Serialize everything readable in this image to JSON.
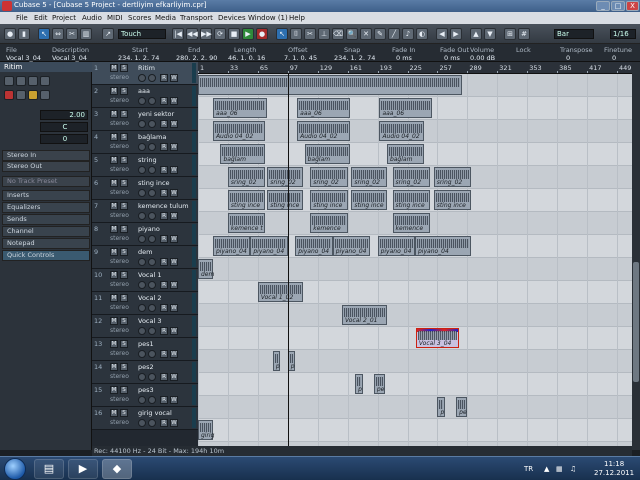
{
  "window": {
    "title": "Cubase 5 - [Cubase 5 Project - dertliyim efkarliyim.cpr]",
    "minimize": "_",
    "maximize": "□",
    "close": "X"
  },
  "menu": [
    "File",
    "Edit",
    "Project",
    "Audio",
    "MIDI",
    "Scores",
    "Media",
    "Transport",
    "Devices",
    "Window (1)",
    "Help"
  ],
  "toolbar": {
    "automation_mode": "Touch",
    "snap_type": "Bar",
    "quantize": "1/16",
    "icons": [
      "arrow-tool",
      "range-tool",
      "split-tool",
      "glue-tool",
      "erase-tool",
      "zoom-tool",
      "mute-tool",
      "draw-tool",
      "play-tool",
      "rewind",
      "forward",
      "stop",
      "play",
      "record",
      "cycle"
    ]
  },
  "infoline": {
    "headers": [
      "File",
      "Description",
      "Start",
      "End",
      "Length",
      "Offset",
      "Snap",
      "Fade In",
      "Fade Out",
      "Volume",
      "Lock",
      "Transpose",
      "Finetune"
    ],
    "values": [
      "Vocal 3_04",
      "Vocal 3_04",
      "234. 1. 2. 74",
      "280. 2. 2. 90",
      "46. 1. 0. 16",
      "7. 1. 0. 45",
      "234. 1. 2. 74",
      "0 ms",
      "0 ms",
      "0.00 dB",
      "",
      "0",
      "0"
    ]
  },
  "inspector": {
    "track_name": "Ritim",
    "volume": "2.00",
    "pan": "C",
    "delay": "0",
    "routing_in": "Stereo In",
    "routing_out": "Stereo Out",
    "preset": "No Track Preset",
    "sections": [
      "Inserts",
      "Equalizers",
      "Sends",
      "Channel",
      "Notepad",
      "Quick Controls"
    ]
  },
  "ruler": {
    "ticks": [
      "1",
      "33",
      "65",
      "97",
      "129",
      "161",
      "193",
      "225",
      "257",
      "289",
      "321",
      "353",
      "385",
      "417",
      "449"
    ]
  },
  "tracks": [
    {
      "num": "1",
      "name": "Ritim",
      "type": "stereo"
    },
    {
      "num": "2",
      "name": "aaa",
      "type": "stereo"
    },
    {
      "num": "3",
      "name": "yeni sektor",
      "type": "stereo"
    },
    {
      "num": "4",
      "name": "bağlama",
      "type": "stereo"
    },
    {
      "num": "5",
      "name": "string",
      "type": "stereo"
    },
    {
      "num": "6",
      "name": "sting ince",
      "type": "stereo"
    },
    {
      "num": "7",
      "name": "kemence tulum",
      "type": "stereo"
    },
    {
      "num": "8",
      "name": "piyano",
      "type": "stereo"
    },
    {
      "num": "9",
      "name": "dem",
      "type": "stereo"
    },
    {
      "num": "10",
      "name": "Vocal 1",
      "type": "stereo"
    },
    {
      "num": "11",
      "name": "Vocal 2",
      "type": "stereo"
    },
    {
      "num": "12",
      "name": "Vocal 3",
      "type": "stereo"
    },
    {
      "num": "13",
      "name": "pes1",
      "type": "stereo"
    },
    {
      "num": "14",
      "name": "pes2",
      "type": "stereo"
    },
    {
      "num": "15",
      "name": "pes3",
      "type": "stereo"
    },
    {
      "num": "16",
      "name": "girig vocal",
      "type": "stereo"
    }
  ],
  "track_buttons": {
    "mute": "M",
    "solo": "S",
    "read": "R",
    "write": "W"
  },
  "events": [
    {
      "track": 0,
      "label": "",
      "from": 1,
      "to": 283
    },
    {
      "track": 1,
      "label": "aaa_06",
      "from": 17,
      "to": 75
    },
    {
      "track": 1,
      "label": "aaa_06",
      "from": 107,
      "to": 163
    },
    {
      "track": 1,
      "label": "aaa_06",
      "from": 195,
      "to": 251
    },
    {
      "track": 2,
      "label": "Audio 04_02",
      "from": 17,
      "to": 73
    },
    {
      "track": 2,
      "label": "Audio 04_02",
      "from": 107,
      "to": 163
    },
    {
      "track": 2,
      "label": "Audio 04_02",
      "from": 195,
      "to": 243
    },
    {
      "track": 3,
      "label": "bağlam",
      "from": 25,
      "to": 73
    },
    {
      "track": 3,
      "label": "bağlam",
      "from": 115,
      "to": 163
    },
    {
      "track": 3,
      "label": "bağlam",
      "from": 203,
      "to": 243
    },
    {
      "track": 4,
      "label": "sring_02",
      "from": 33,
      "to": 73
    },
    {
      "track": 4,
      "label": "sring_02",
      "from": 75,
      "to": 113
    },
    {
      "track": 4,
      "label": "sring_02",
      "from": 121,
      "to": 161
    },
    {
      "track": 4,
      "label": "sring_02",
      "from": 165,
      "to": 203
    },
    {
      "track": 4,
      "label": "sring_02",
      "from": 209,
      "to": 249
    },
    {
      "track": 4,
      "label": "sring_02",
      "from": 253,
      "to": 293
    },
    {
      "track": 5,
      "label": "sting ince",
      "from": 33,
      "to": 73
    },
    {
      "track": 5,
      "label": "sting ince",
      "from": 75,
      "to": 113
    },
    {
      "track": 5,
      "label": "sting ince",
      "from": 121,
      "to": 161
    },
    {
      "track": 5,
      "label": "sting ince",
      "from": 165,
      "to": 203
    },
    {
      "track": 5,
      "label": "sting ince",
      "from": 209,
      "to": 249
    },
    {
      "track": 5,
      "label": "sting ince",
      "from": 253,
      "to": 293
    },
    {
      "track": 6,
      "label": "kemence t",
      "from": 33,
      "to": 73
    },
    {
      "track": 6,
      "label": "kemence",
      "from": 121,
      "to": 161
    },
    {
      "track": 6,
      "label": "kemence",
      "from": 209,
      "to": 249
    },
    {
      "track": 7,
      "label": "piyano_04",
      "from": 17,
      "to": 57
    },
    {
      "track": 7,
      "label": "piyano_04",
      "from": 57,
      "to": 97
    },
    {
      "track": 7,
      "label": "piyano_04",
      "from": 105,
      "to": 145
    },
    {
      "track": 7,
      "label": "piyano_04",
      "from": 145,
      "to": 185
    },
    {
      "track": 7,
      "label": "piyano_04",
      "from": 193,
      "to": 233
    },
    {
      "track": 7,
      "label": "piyano_04",
      "from": 233,
      "to": 293
    },
    {
      "track": 8,
      "label": "dem",
      "from": 1,
      "to": 17
    },
    {
      "track": 9,
      "label": "Vocal 1_02",
      "from": 65,
      "to": 113
    },
    {
      "track": 10,
      "label": "Vocal 2_01",
      "from": 155,
      "to": 203
    },
    {
      "track": 11,
      "label": "Vocal 3_04",
      "from": 234,
      "to": 280,
      "selected": true
    },
    {
      "track": 12,
      "label": "p",
      "from": 81,
      "to": 89
    },
    {
      "track": 12,
      "label": "p",
      "from": 97,
      "to": 105
    },
    {
      "track": 13,
      "label": "p",
      "from": 169,
      "to": 177
    },
    {
      "track": 13,
      "label": "pe",
      "from": 189,
      "to": 201
    },
    {
      "track": 14,
      "label": "p",
      "from": 257,
      "to": 265
    },
    {
      "track": 14,
      "label": "pe",
      "from": 277,
      "to": 289
    },
    {
      "track": 15,
      "label": "girig",
      "from": 1,
      "to": 17
    }
  ],
  "cursor_bar": 97,
  "status": "Rec: 44100 Hz - 24 Bit - Max: 194h 10m",
  "taskbar": {
    "language": "TR",
    "time": "11:18",
    "date": "27.12.2011"
  }
}
